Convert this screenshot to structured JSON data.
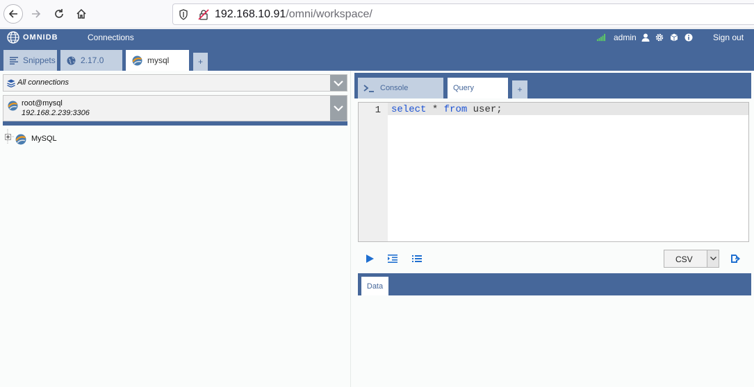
{
  "browser": {
    "url_host": "192.168.10.91",
    "url_path": "/omni/workspace/"
  },
  "header": {
    "brand": "OMNIDB",
    "connections_label": "Connections",
    "user": "admin",
    "signout_label": "Sign out"
  },
  "outer_tabs": [
    {
      "label": "Snippets",
      "icon": "snippets-icon"
    },
    {
      "label": "2.17.0",
      "icon": "globe-icon"
    },
    {
      "label": "mysql",
      "icon": "mysql-icon"
    },
    {
      "label": "+"
    }
  ],
  "left": {
    "all_connections": "All connections",
    "connection_user": "root@mysql",
    "connection_host": "192.168.2.239:3306",
    "tree_root": "MySQL"
  },
  "inner_tabs": {
    "console_label": "Console",
    "query_label": "Query",
    "plus_label": "+"
  },
  "editor": {
    "line_number": "1",
    "kw_select": "select",
    "star": " * ",
    "kw_from": "from",
    "rest": " user;"
  },
  "toolbar": {
    "format_value": "CSV"
  },
  "results": {
    "data_tab": "Data"
  },
  "colors": {
    "primary": "#46679a",
    "tab_inactive": "#c3d0e1",
    "action_blue": "#1f6fd0"
  }
}
